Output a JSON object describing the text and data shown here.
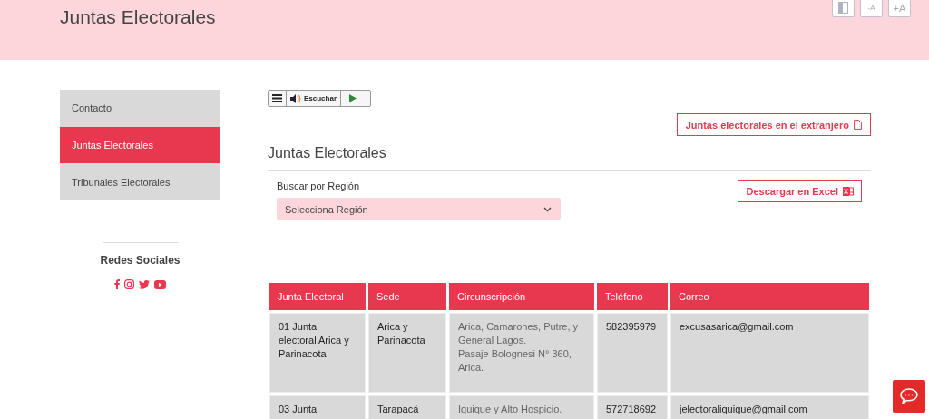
{
  "header": {
    "title": "Juntas Electorales",
    "tools": [
      {
        "kind": "contrast"
      },
      {
        "kind": "smaller",
        "label": "-A"
      },
      {
        "kind": "larger",
        "label": "+A"
      }
    ]
  },
  "sidebar": {
    "items": [
      {
        "label": "Contacto",
        "selected": false
      },
      {
        "label": "Juntas Electorales",
        "selected": true
      },
      {
        "label": "Tribunales Electorales",
        "selected": false
      }
    ],
    "social_title": "Redes Sociales"
  },
  "reader": {
    "label": "Escuchar"
  },
  "abroad_link": "Juntas electorales en el extranjero",
  "section_title": "Juntas Electorales",
  "filter": {
    "label": "Buscar por Región",
    "placeholder": "Selecciona Región"
  },
  "excel_button": "Descargar en Excel",
  "table": {
    "columns": [
      "Junta Electoral",
      "Sede",
      "Circunscripción",
      "Teléfono",
      "Correo"
    ],
    "rows": [
      {
        "cells": [
          "01 Junta electoral Arica y Parinacota",
          "Arica y Parinacota",
          [
            "Arica, Camarones, Putre, y General Lagos.",
            "Pasaje Bolognesi N° 360, Arica."
          ],
          "582395979",
          "excusasarica@gmail.com"
        ]
      },
      {
        "cells": [
          "03 Junta",
          "Tarapacá",
          [
            "Iquique y Alto Hospicio."
          ],
          "572718692",
          "jelectoraliquique@gmail.com"
        ]
      }
    ]
  }
}
